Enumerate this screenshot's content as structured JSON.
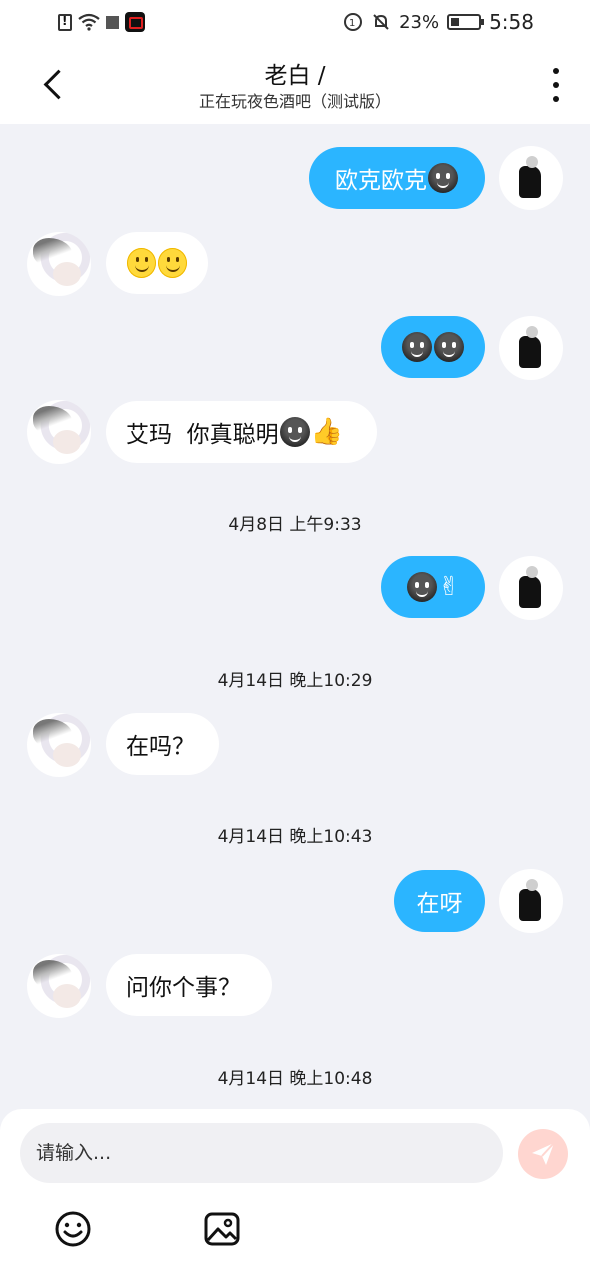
{
  "status_bar": {
    "battery": "23%",
    "time": "5:58"
  },
  "header": {
    "title": "老白 /",
    "subtitle": "正在玩夜色酒吧（测试版）"
  },
  "messages": [
    {
      "side": "right",
      "text": "欧克欧克",
      "emojis": [
        "dark-grin"
      ]
    },
    {
      "side": "left",
      "text": "",
      "emojis": [
        "smile",
        "smile"
      ]
    },
    {
      "side": "right",
      "text": "",
      "emojis": [
        "dark-grin",
        "dark-grin"
      ]
    },
    {
      "side": "left",
      "text": "艾玛  你真聪明",
      "emojis": [
        "dark-grin",
        "thumbs-up"
      ]
    },
    {
      "timestamp": "4月8日 上午9:33"
    },
    {
      "side": "right",
      "text": "",
      "emojis": [
        "dark-grin",
        "victory-hand"
      ]
    },
    {
      "timestamp": "4月14日 晚上10:29"
    },
    {
      "side": "left",
      "text": "在吗？"
    },
    {
      "timestamp": "4月14日 晚上10:43"
    },
    {
      "side": "right",
      "text": "在呀"
    },
    {
      "side": "left",
      "text": "问你个事？"
    },
    {
      "timestamp": "4月14日 晚上10:48"
    }
  ],
  "input": {
    "placeholder": "请输入..."
  },
  "colors": {
    "my_bubble": "#2bb5ff",
    "their_bubble": "#ffffff",
    "background": "#f1f2f7",
    "send_button": "#ffd6d0"
  }
}
